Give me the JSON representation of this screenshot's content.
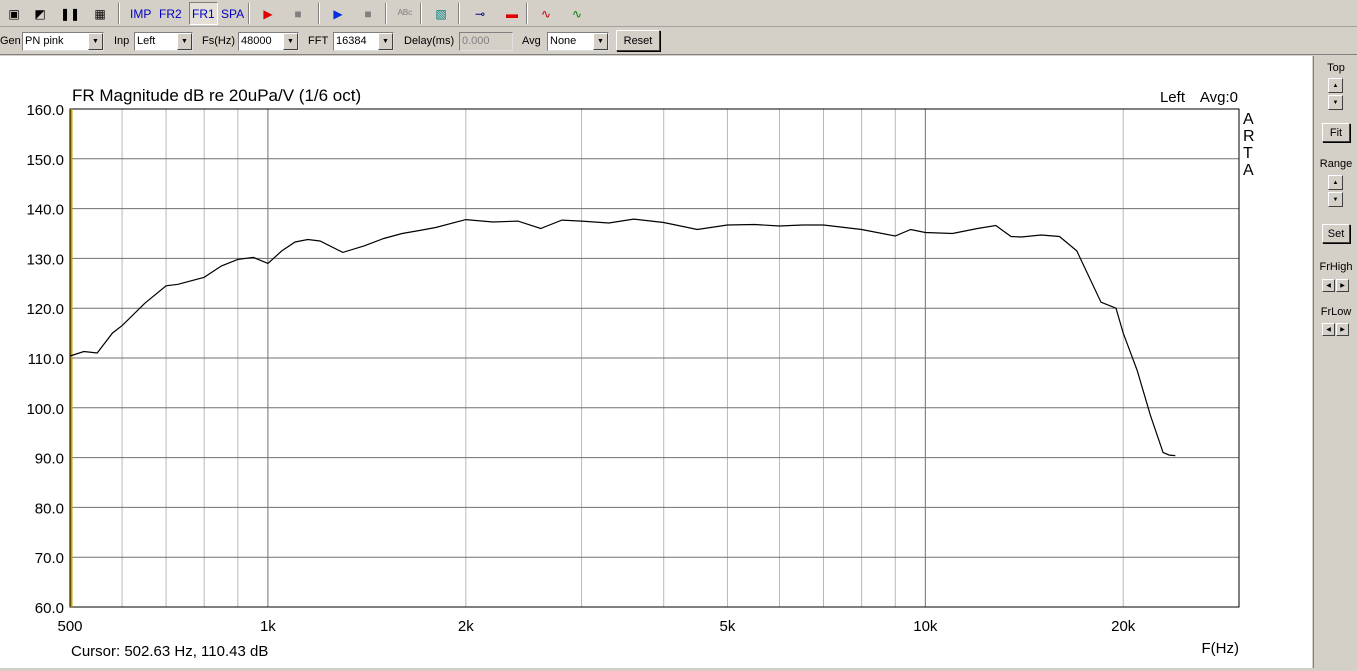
{
  "toolbar": {
    "items": [
      {
        "name": "open-icon",
        "type": "icon"
      },
      {
        "name": "save-icon",
        "type": "icon"
      },
      {
        "name": "pause-icon",
        "type": "icon"
      },
      {
        "name": "grid-icon",
        "type": "icon"
      },
      {
        "name": "imp-button",
        "label": "IMP"
      },
      {
        "name": "fr2-button",
        "label": "FR2"
      },
      {
        "name": "fr1-button",
        "label": "FR1",
        "active": true
      },
      {
        "name": "spa-button",
        "label": "SPA"
      },
      {
        "name": "record-red-icon",
        "type": "icon"
      },
      {
        "name": "stop-icon",
        "type": "icon"
      },
      {
        "name": "play-blue-icon",
        "type": "icon"
      },
      {
        "name": "stop2-icon",
        "type": "icon"
      },
      {
        "name": "abc-icon",
        "type": "icon"
      },
      {
        "name": "calibrate-icon",
        "type": "icon"
      },
      {
        "name": "probe-icon",
        "type": "icon"
      },
      {
        "name": "level-meter-icon",
        "type": "icon"
      },
      {
        "name": "generator-icon",
        "type": "icon"
      },
      {
        "name": "scope-icon",
        "type": "icon"
      }
    ]
  },
  "controls": {
    "gen_label": "Gen",
    "gen_value": "PN pink",
    "inp_label": "Inp",
    "inp_value": "Left",
    "fs_label": "Fs(Hz)",
    "fs_value": "48000",
    "fft_label": "FFT",
    "fft_value": "16384",
    "delay_label": "Delay(ms)",
    "delay_value": "0.000",
    "avg_label": "Avg",
    "avg_value": "None",
    "reset_label": "Reset"
  },
  "side": {
    "top_label": "Top",
    "fit_label": "Fit",
    "range_label": "Range",
    "set_label": "Set",
    "frhigh_label": "FrHigh",
    "frlow_label": "FrLow"
  },
  "status": {
    "cursor": "Cursor: 502.63 Hz, 110.43 dB"
  },
  "chart_data": {
    "type": "line",
    "title": "FR Magnitude dB re 20uPa/V (1/6 oct)",
    "channel_label": "Left",
    "avg_label": "Avg:0",
    "watermark": "ARTA",
    "xlabel": "F(Hz)",
    "ylabel": "",
    "x_scale": "log",
    "xlim": [
      500,
      30000
    ],
    "ylim": [
      60,
      160
    ],
    "y_ticks": [
      "160.0",
      "150.0",
      "140.0",
      "130.0",
      "120.0",
      "110.0",
      "100.0",
      "90.0",
      "80.0",
      "70.0",
      "60.0"
    ],
    "x_ticks": [
      {
        "value": 500,
        "label": "500"
      },
      {
        "value": 1000,
        "label": "1k"
      },
      {
        "value": 2000,
        "label": "2k"
      },
      {
        "value": 5000,
        "label": "5k"
      },
      {
        "value": 10000,
        "label": "10k"
      },
      {
        "value": 20000,
        "label": "20k"
      }
    ],
    "grid": true,
    "line_color": "#000000",
    "cursor_color": "#c8a000",
    "cursor_x": 502.63,
    "series": [
      {
        "x": [
          500,
          525,
          550,
          580,
          600,
          650,
          700,
          730,
          800,
          850,
          900,
          950,
          1000,
          1050,
          1100,
          1150,
          1200,
          1300,
          1400,
          1500,
          1600,
          1700,
          1800,
          2000,
          2200,
          2400,
          2600,
          2800,
          3000,
          3300,
          3600,
          4000,
          4500,
          5000,
          5500,
          6000,
          6500,
          7000,
          8000,
          9000,
          9500,
          10000,
          11000,
          12000,
          12800,
          13500,
          14000,
          15000,
          16000,
          17000,
          18500,
          19500,
          20000,
          21000,
          22000,
          23000,
          23500,
          24000
        ],
        "y": [
          110.4,
          111.3,
          111.0,
          115.0,
          116.5,
          121.0,
          124.5,
          124.8,
          126.2,
          128.5,
          129.8,
          130.2,
          129.0,
          131.5,
          133.3,
          133.8,
          133.5,
          131.2,
          132.5,
          134.0,
          135.0,
          135.6,
          136.2,
          137.8,
          137.3,
          137.5,
          136.0,
          137.7,
          137.5,
          137.1,
          137.9,
          137.2,
          135.8,
          136.7,
          136.8,
          136.5,
          136.7,
          136.7,
          135.8,
          134.5,
          135.8,
          135.2,
          135.0,
          136.0,
          136.6,
          134.4,
          134.3,
          134.7,
          134.4,
          131.5,
          121.2,
          120.0,
          115.0,
          107.5,
          98.5,
          91.0,
          90.5,
          90.4
        ]
      }
    ]
  }
}
